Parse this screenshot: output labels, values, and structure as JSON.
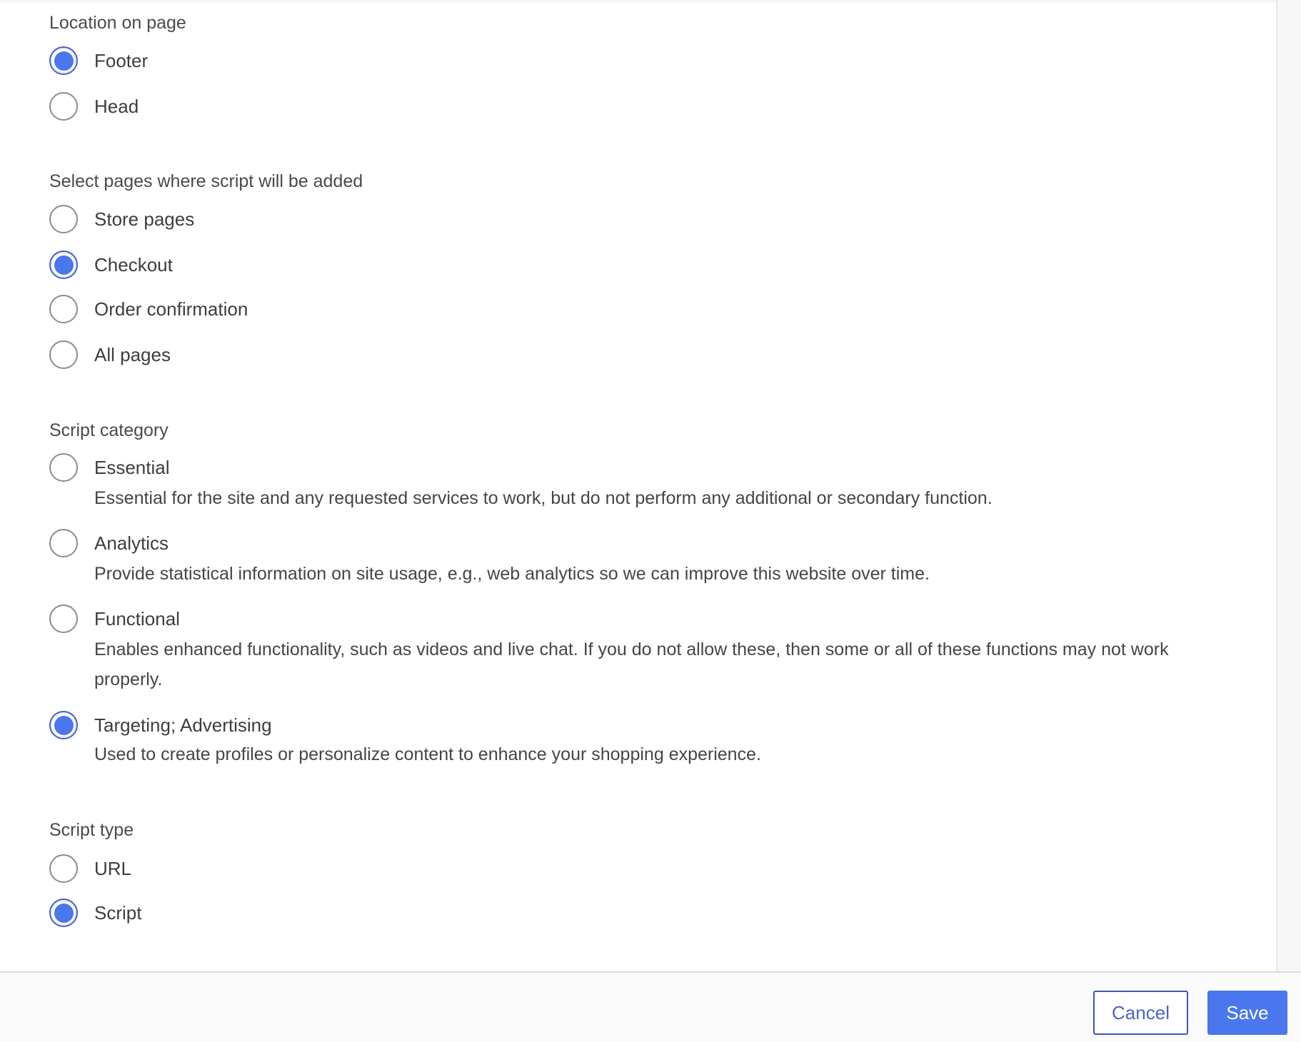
{
  "sections": {
    "location": {
      "label": "Location on page",
      "options": [
        {
          "label": "Footer",
          "checked": true
        },
        {
          "label": "Head",
          "checked": false
        }
      ]
    },
    "pages": {
      "label": "Select pages where script will be added",
      "options": [
        {
          "label": "Store pages",
          "checked": false
        },
        {
          "label": "Checkout",
          "checked": true
        },
        {
          "label": "Order confirmation",
          "checked": false
        },
        {
          "label": "All pages",
          "checked": false
        }
      ]
    },
    "category": {
      "label": "Script category",
      "options": [
        {
          "label": "Essential",
          "checked": false,
          "description": "Essential for the site and any requested services to work, but do not perform any additional or secondary function."
        },
        {
          "label": "Analytics",
          "checked": false,
          "description": "Provide statistical information on site usage, e.g., web analytics so we can improve this website over time."
        },
        {
          "label": "Functional",
          "checked": false,
          "description": "Enables enhanced functionality, such as videos and live chat. If you do not allow these, then some or all of these functions may not work properly."
        },
        {
          "label": "Targeting; Advertising",
          "checked": true,
          "description": "Used to create profiles or personalize content to enhance your shopping experience."
        }
      ]
    },
    "type": {
      "label": "Script type",
      "options": [
        {
          "label": "URL",
          "checked": false
        },
        {
          "label": "Script",
          "checked": true
        }
      ]
    }
  },
  "footer": {
    "cancel_label": "Cancel",
    "save_label": "Save"
  },
  "colors": {
    "accent": "#4a76ee",
    "radio_border_checked": "#4a5fc7",
    "radio_border": "#8c8c8c"
  }
}
